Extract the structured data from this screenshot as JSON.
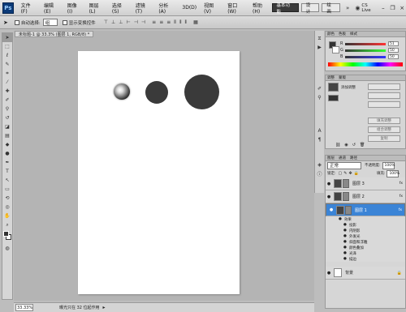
{
  "app": {
    "logo": "Ps",
    "zoom_select": "33.3",
    "title": "CS Live"
  },
  "menubar": {
    "items": [
      "文件(F)",
      "编辑(E)",
      "图像(I)",
      "图层(L)",
      "选择(S)",
      "滤镜(T)",
      "分析(A)",
      "3D(D)",
      "视图(V)",
      "窗口(W)",
      "帮助(H)"
    ],
    "workspaces": [
      "基本功能",
      "设计",
      "绘画"
    ]
  },
  "options": {
    "auto_select": "自动选择:",
    "auto_select_value": "组",
    "transform": "显示变换控件"
  },
  "document": {
    "tab": "未标题-1 @ 33.3% (图层 1, RGB/8) *",
    "zoom": "33.33%",
    "status": "曝光只在 32 位起作用"
  },
  "color_panel": {
    "tabs": [
      "颜色",
      "色板",
      "样式"
    ],
    "channels": [
      {
        "label": "R",
        "value": "51"
      },
      {
        "label": "G",
        "value": "50"
      },
      {
        "label": "B",
        "value": "50"
      }
    ]
  },
  "adjust_panel": {
    "tabs": [
      "调整",
      "蒙版"
    ],
    "title": "添加调整",
    "buttons": [
      "图层",
      " ",
      "合并形状组件",
      "删除图层",
      "载入"
    ],
    "btn_labels": [
      "填充调整",
      "组合调整",
      "复制"
    ]
  },
  "layers_panel": {
    "tabs": [
      "图层",
      "通道",
      "路径"
    ],
    "blend_mode": "正常",
    "opacity_label": "不透明度:",
    "opacity": "100%",
    "lock_label": "锁定:",
    "fill_label": "填充:",
    "fill": "100%",
    "layers": [
      {
        "name": "图层 3",
        "fx": "fx"
      },
      {
        "name": "图层 2",
        "fx": "fx"
      },
      {
        "name": "图层 1",
        "fx": "fx"
      }
    ],
    "effects_label": "效果",
    "effects": [
      "投影",
      "内阴影",
      "外发光",
      "斜面和浮雕",
      "颜色叠加",
      "光泽",
      "描边"
    ],
    "background": "背景"
  },
  "colors": {
    "accent": "#3b84d6",
    "circle": "#3a3a3a"
  }
}
